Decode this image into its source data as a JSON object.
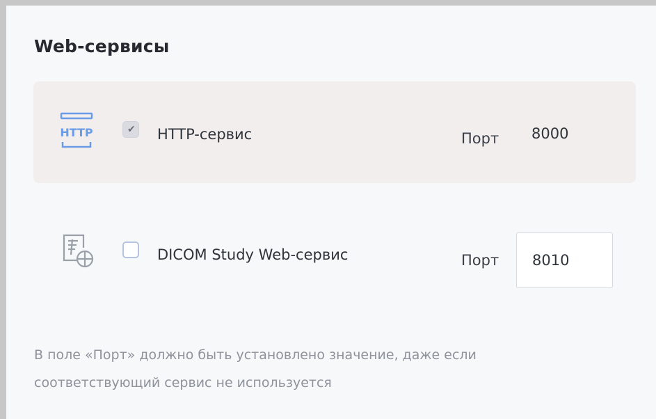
{
  "section": {
    "title": "Web-сервисы"
  },
  "services": [
    {
      "icon": "http-icon",
      "checked": true,
      "label": "HTTP-сервис",
      "port_label": "Порт",
      "port_value": "8000",
      "highlighted": true
    },
    {
      "icon": "dicom-web-icon",
      "checked": false,
      "label": "DICOM Study Web-сервис",
      "port_label": "Порт",
      "port_value": "8010",
      "highlighted": false
    }
  ],
  "note": "В поле «Порт» должно быть установлено значение, даже если соответствующий сервис не используется",
  "colors": {
    "accent_icon": "#6a9be6",
    "muted_icon": "#9aa0a8",
    "highlight_row": "#f3eeee",
    "checkbox_border": "#b5c3e0"
  }
}
